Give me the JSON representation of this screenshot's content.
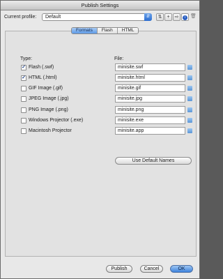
{
  "window": {
    "title": "Publish Settings"
  },
  "profile": {
    "label": "Current profile:",
    "selected": "Default",
    "tools": [
      "duplicate-profile-icon",
      "add-profile-icon",
      "import-export-icon",
      "info-icon",
      "delete-profile-icon"
    ]
  },
  "tabs": [
    {
      "label": "Formats",
      "active": true
    },
    {
      "label": "Flash",
      "active": false
    },
    {
      "label": "HTML",
      "active": false
    }
  ],
  "formats": {
    "type_header": "Type:",
    "file_header": "File:",
    "rows": [
      {
        "label": "Flash  (.swf)",
        "checked": true,
        "file": "minisite.swf"
      },
      {
        "label": "HTML  (.html)",
        "checked": true,
        "file": "minisite.html"
      },
      {
        "label": "GIF Image  (.gif)",
        "checked": false,
        "file": "minisite.gif"
      },
      {
        "label": "JPEG Image  (.jpg)",
        "checked": false,
        "file": "minisite.jpg"
      },
      {
        "label": "PNG Image  (.png)",
        "checked": false,
        "file": "minisite.png"
      },
      {
        "label": "Windows Projector  (.exe)",
        "checked": false,
        "file": "minisite.exe"
      },
      {
        "label": "Macintosh Projector",
        "checked": false,
        "file": "minisite.app"
      }
    ],
    "default_names_label": "Use Default Names"
  },
  "footer": {
    "publish_label": "Publish",
    "cancel_label": "Cancel",
    "ok_label": "OK"
  },
  "colors": {
    "accent": "#4a8be0",
    "check": "#1f3f86"
  }
}
